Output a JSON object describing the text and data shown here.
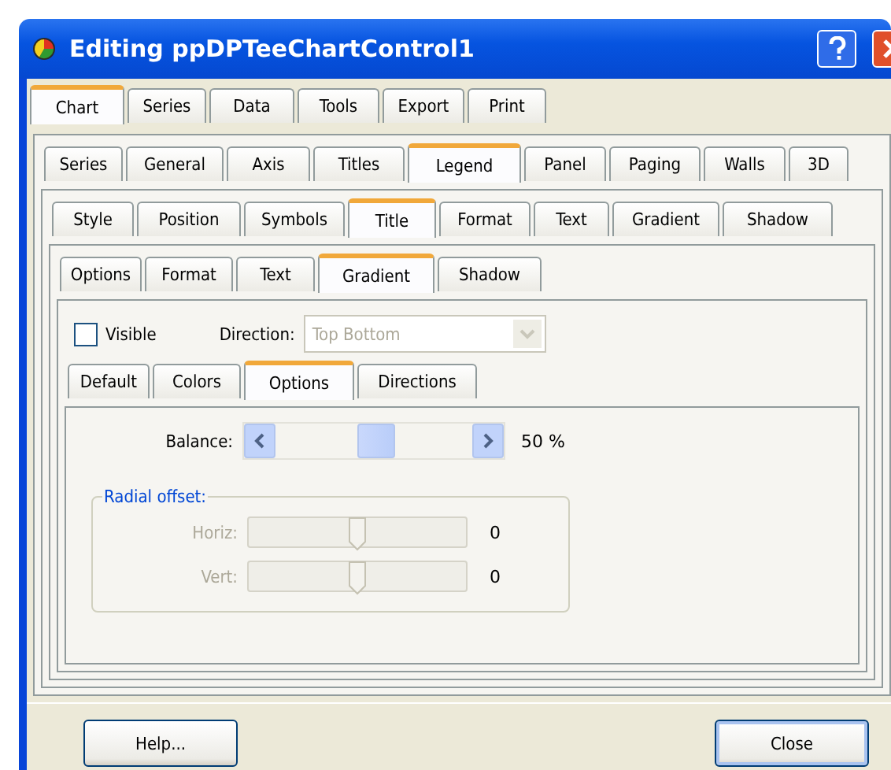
{
  "window": {
    "title": "Editing ppDPTeeChartControl1"
  },
  "tab_rows": [
    [
      {
        "label": "Chart",
        "selected": true
      },
      {
        "label": "Series",
        "selected": false
      },
      {
        "label": "Data",
        "selected": false
      },
      {
        "label": "Tools",
        "selected": false
      },
      {
        "label": "Export",
        "selected": false
      },
      {
        "label": "Print",
        "selected": false
      }
    ],
    [
      {
        "label": "Series",
        "selected": false
      },
      {
        "label": "General",
        "selected": false
      },
      {
        "label": "Axis",
        "selected": false
      },
      {
        "label": "Titles",
        "selected": false
      },
      {
        "label": "Legend",
        "selected": true
      },
      {
        "label": "Panel",
        "selected": false
      },
      {
        "label": "Paging",
        "selected": false
      },
      {
        "label": "Walls",
        "selected": false
      },
      {
        "label": "3D",
        "selected": false
      }
    ],
    [
      {
        "label": "Style",
        "selected": false
      },
      {
        "label": "Position",
        "selected": false
      },
      {
        "label": "Symbols",
        "selected": false
      },
      {
        "label": "Title",
        "selected": true
      },
      {
        "label": "Format",
        "selected": false
      },
      {
        "label": "Text",
        "selected": false
      },
      {
        "label": "Gradient",
        "selected": false
      },
      {
        "label": "Shadow",
        "selected": false
      }
    ],
    [
      {
        "label": "Options",
        "selected": false
      },
      {
        "label": "Format",
        "selected": false
      },
      {
        "label": "Text",
        "selected": false
      },
      {
        "label": "Gradient",
        "selected": true
      },
      {
        "label": "Shadow",
        "selected": false
      }
    ],
    [
      {
        "label": "Default",
        "selected": false
      },
      {
        "label": "Colors",
        "selected": false
      },
      {
        "label": "Options",
        "selected": true
      },
      {
        "label": "Directions",
        "selected": false
      }
    ]
  ],
  "visible": {
    "label": "Visible",
    "checked": false
  },
  "direction": {
    "label": "Direction:",
    "value": "Top Bottom",
    "disabled": true
  },
  "balance": {
    "label": "Balance:",
    "reading": "50 %"
  },
  "radial_offset": {
    "title": "Radial offset:",
    "disabled": true,
    "sliders": [
      {
        "label": "Horiz:",
        "level": 0.5,
        "reading": "0"
      },
      {
        "label": "Vert:",
        "level": 0.5,
        "reading": "0"
      }
    ]
  },
  "buttons": [
    {
      "label": "Help...",
      "default": false
    },
    {
      "label": "Close",
      "default": true
    }
  ]
}
